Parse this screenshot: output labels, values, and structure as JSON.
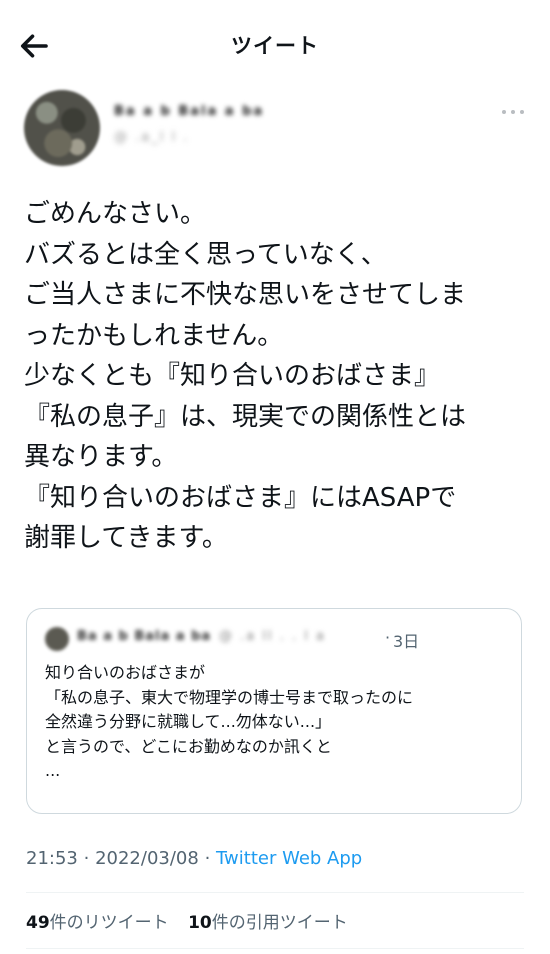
{
  "header": {
    "title": "ツイート",
    "back_icon": "arrow-left-icon"
  },
  "author": {
    "name": "Ba a b Bala a ba",
    "handle": "@ .a_l l .",
    "more_icon": "more-horizontal-icon"
  },
  "tweet": {
    "lines": [
      "ごめんなさい。",
      "バズるとは全く思っていなく、",
      "ご当人さまに不快な思いをさせてしま",
      "ったかもしれません。",
      "少なくとも『知り合いのおばさま』",
      "『私の息子』は、現実での関係性とは",
      "異なります。",
      "『知り合いのおばさま』にはASAPで",
      "謝罪してきます。"
    ]
  },
  "quote": {
    "name": "Ba a b Bala a ba",
    "handle": "@ .a ll . . l a",
    "dot": "·",
    "time": "3日",
    "lines": [
      "知り合いのおばさまが",
      "「私の息子、東大で物理学の博士号まで取ったのに",
      "全然違う分野に就職して...勿体ない...」",
      "と言うので、どこにお勤めなのか訊くと",
      "..."
    ]
  },
  "meta": {
    "time": "21:53",
    "sep1": "·",
    "date": "2022/03/08",
    "sep2": "·",
    "via": "Twitter Web App"
  },
  "stats": {
    "retweets_count": "49",
    "retweets_label": "件のリツイート",
    "quotes_count": "10",
    "quotes_label": "件の引用ツイート"
  },
  "colors": {
    "text": "#0f1419",
    "secondary": "#536471",
    "link": "#1d9bf0",
    "border": "#cfd9de"
  }
}
